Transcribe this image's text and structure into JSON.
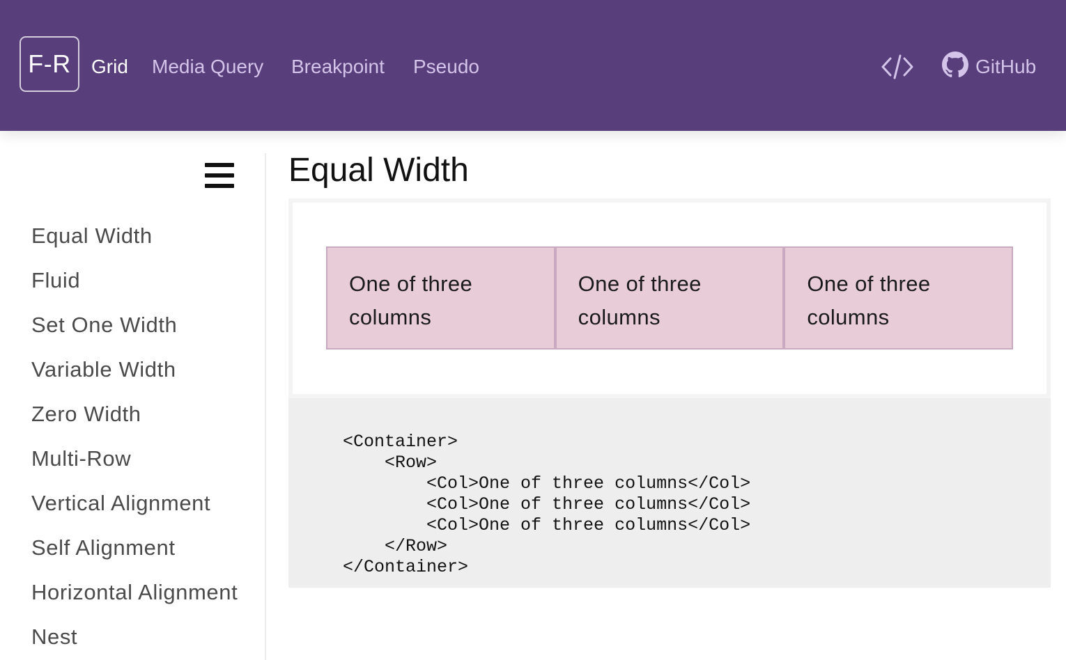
{
  "header": {
    "brand": "F-R",
    "nav": [
      {
        "label": "Grid",
        "active": true
      },
      {
        "label": "Media Query",
        "active": false
      },
      {
        "label": "Breakpoint",
        "active": false
      },
      {
        "label": "Pseudo",
        "active": false
      }
    ],
    "source_icon": "code-icon",
    "github": {
      "label": "GitHub",
      "icon": "github-icon"
    },
    "colors": {
      "bar": "#583e7b",
      "link": "#d4c4ea",
      "active": "#ffffff"
    }
  },
  "sidebar": {
    "menu_icon": "hamburger-icon",
    "items": [
      {
        "label": "Equal Width"
      },
      {
        "label": "Fluid"
      },
      {
        "label": "Set One Width"
      },
      {
        "label": "Variable Width"
      },
      {
        "label": "Zero Width"
      },
      {
        "label": "Multi-Row"
      },
      {
        "label": "Vertical Alignment"
      },
      {
        "label": "Self Alignment"
      },
      {
        "label": "Horizontal Alignment"
      },
      {
        "label": "Nest"
      }
    ]
  },
  "main": {
    "title": "Equal Width",
    "demo": {
      "columns": [
        {
          "text": "One of three columns"
        },
        {
          "text": "One of three columns"
        },
        {
          "text": "One of three columns"
        }
      ],
      "cell_color": "#e8ccd8"
    },
    "code": "<Container>\n    <Row>\n        <Col>One of three columns</Col>\n        <Col>One of three columns</Col>\n        <Col>One of three columns</Col>\n    </Row>\n</Container>"
  }
}
